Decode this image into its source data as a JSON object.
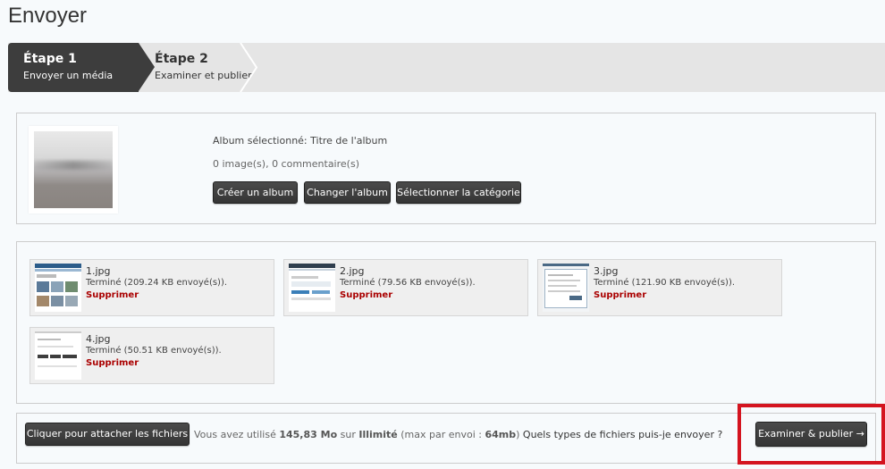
{
  "page": {
    "title": "Envoyer"
  },
  "steps": [
    {
      "title": "Étape 1",
      "subtitle": "Envoyer un média",
      "active": true
    },
    {
      "title": "Étape 2",
      "subtitle": "Examiner et publier",
      "active": false
    }
  ],
  "album": {
    "selected_label": "Album sélectionné: Titre de l'album",
    "counts": "0 image(s), 0 commentaire(s)",
    "buttons": {
      "create": "Créer un album",
      "change": "Changer l'album",
      "category": "Sélectionner la catégorie"
    }
  },
  "files": [
    {
      "name": "1.jpg",
      "status": "Terminé (209.24 KB envoyé(s)).",
      "delete": "Supprimer"
    },
    {
      "name": "2.jpg",
      "status": "Terminé (79.56 KB envoyé(s)).",
      "delete": "Supprimer"
    },
    {
      "name": "3.jpg",
      "status": "Terminé (121.90 KB envoyé(s)).",
      "delete": "Supprimer"
    },
    {
      "name": "4.jpg",
      "status": "Terminé (50.51 KB envoyé(s)).",
      "delete": "Supprimer"
    }
  ],
  "footer": {
    "attach_label": "Cliquer pour attacher les fichiers",
    "usage_prefix": "Vous avez utilisé",
    "used": "145,83 Mo",
    "usage_on": "sur",
    "limit": "Illimité",
    "max_prefix": "(max par envoi :",
    "max_value": "64mb",
    "max_suffix": ")",
    "types_link": "Quels types de fichiers puis-je envoyer ?",
    "publish_label": "Examiner & publier →"
  },
  "colors": {
    "highlight": "#d4141f",
    "delete": "#aa0000",
    "button_dark": "#3d3d3d"
  }
}
